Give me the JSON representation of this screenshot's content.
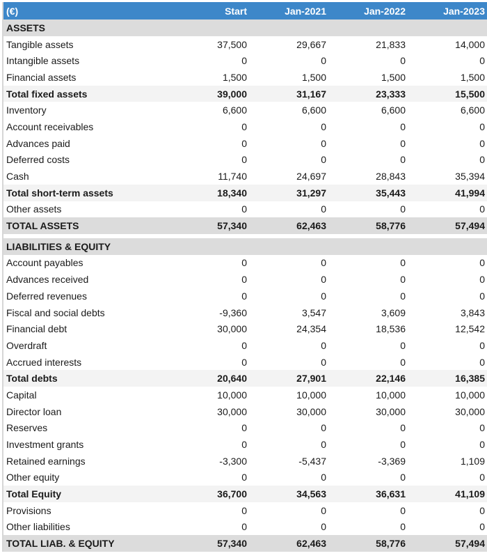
{
  "header": {
    "unit": "(€)",
    "columns": [
      "Start",
      "Jan-2021",
      "Jan-2022",
      "Jan-2023"
    ]
  },
  "rows": [
    {
      "type": "section",
      "label": "ASSETS",
      "values": [
        "",
        "",
        "",
        ""
      ]
    },
    {
      "type": "normal",
      "label": "Tangible assets",
      "values": [
        "37,500",
        "29,667",
        "21,833",
        "14,000"
      ]
    },
    {
      "type": "normal",
      "label": "Intangible assets",
      "values": [
        "0",
        "0",
        "0",
        "0"
      ]
    },
    {
      "type": "normal",
      "label": "Financial assets",
      "values": [
        "1,500",
        "1,500",
        "1,500",
        "1,500"
      ]
    },
    {
      "type": "subtotal",
      "label": "Total fixed assets",
      "values": [
        "39,000",
        "31,167",
        "23,333",
        "15,500"
      ]
    },
    {
      "type": "normal",
      "label": "Inventory",
      "values": [
        "6,600",
        "6,600",
        "6,600",
        "6,600"
      ]
    },
    {
      "type": "normal",
      "label": "Account receivables",
      "values": [
        "0",
        "0",
        "0",
        "0"
      ]
    },
    {
      "type": "normal",
      "label": "Advances paid",
      "values": [
        "0",
        "0",
        "0",
        "0"
      ]
    },
    {
      "type": "normal",
      "label": "Deferred costs",
      "values": [
        "0",
        "0",
        "0",
        "0"
      ]
    },
    {
      "type": "normal",
      "label": "Cash",
      "values": [
        "11,740",
        "24,697",
        "28,843",
        "35,394"
      ]
    },
    {
      "type": "subtotal",
      "label": "Total short-term assets",
      "values": [
        "18,340",
        "31,297",
        "35,443",
        "41,994"
      ]
    },
    {
      "type": "normal",
      "label": "Other assets",
      "values": [
        "0",
        "0",
        "0",
        "0"
      ]
    },
    {
      "type": "grand",
      "label": "TOTAL ASSETS",
      "values": [
        "57,340",
        "62,463",
        "58,776",
        "57,494"
      ]
    },
    {
      "type": "spacer",
      "label": "",
      "values": [
        "",
        "",
        "",
        ""
      ]
    },
    {
      "type": "section",
      "label": "LIABILITIES & EQUITY",
      "values": [
        "",
        "",
        "",
        ""
      ]
    },
    {
      "type": "normal",
      "label": "Account payables",
      "values": [
        "0",
        "0",
        "0",
        "0"
      ]
    },
    {
      "type": "normal",
      "label": "Advances received",
      "values": [
        "0",
        "0",
        "0",
        "0"
      ]
    },
    {
      "type": "normal",
      "label": "Deferred revenues",
      "values": [
        "0",
        "0",
        "0",
        "0"
      ]
    },
    {
      "type": "normal",
      "label": "Fiscal and social debts",
      "values": [
        "-9,360",
        "3,547",
        "3,609",
        "3,843"
      ]
    },
    {
      "type": "normal",
      "label": "Financial debt",
      "values": [
        "30,000",
        "24,354",
        "18,536",
        "12,542"
      ]
    },
    {
      "type": "normal",
      "label": "Overdraft",
      "values": [
        "0",
        "0",
        "0",
        "0"
      ]
    },
    {
      "type": "normal",
      "label": "Accrued interests",
      "values": [
        "0",
        "0",
        "0",
        "0"
      ]
    },
    {
      "type": "subtotal",
      "label": "Total debts",
      "values": [
        "20,640",
        "27,901",
        "22,146",
        "16,385"
      ]
    },
    {
      "type": "normal",
      "label": "Capital",
      "values": [
        "10,000",
        "10,000",
        "10,000",
        "10,000"
      ]
    },
    {
      "type": "normal",
      "label": "Director loan",
      "values": [
        "30,000",
        "30,000",
        "30,000",
        "30,000"
      ]
    },
    {
      "type": "normal",
      "label": "Reserves",
      "values": [
        "0",
        "0",
        "0",
        "0"
      ]
    },
    {
      "type": "normal",
      "label": "Investment grants",
      "values": [
        "0",
        "0",
        "0",
        "0"
      ]
    },
    {
      "type": "normal",
      "label": "Retained earnings",
      "values": [
        "-3,300",
        "-5,437",
        "-3,369",
        "1,109"
      ]
    },
    {
      "type": "normal",
      "label": "Other equity",
      "values": [
        "0",
        "0",
        "0",
        "0"
      ]
    },
    {
      "type": "subtotal",
      "label": "Total Equity",
      "values": [
        "36,700",
        "34,563",
        "36,631",
        "41,109"
      ]
    },
    {
      "type": "normal",
      "label": "Provisions",
      "values": [
        "0",
        "0",
        "0",
        "0"
      ]
    },
    {
      "type": "normal",
      "label": "Other liabilities",
      "values": [
        "0",
        "0",
        "0",
        "0"
      ]
    },
    {
      "type": "grand",
      "label": "TOTAL LIAB. & EQUITY",
      "values": [
        "57,340",
        "62,463",
        "58,776",
        "57,494"
      ]
    }
  ],
  "colors": {
    "header_bg": "#3d87c9",
    "section_bg": "#dcdcdc",
    "subtotal_bg": "#f3f3f3",
    "grand_total_bg": "#dcdcdc"
  }
}
